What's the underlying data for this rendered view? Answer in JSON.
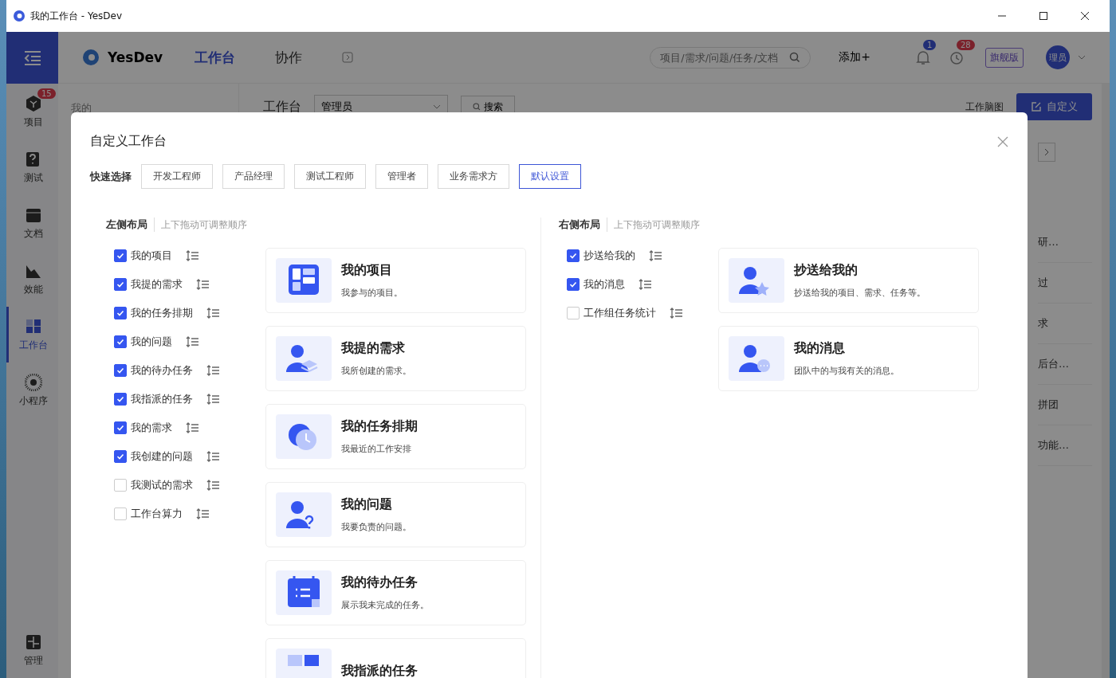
{
  "window": {
    "title": "我的工作台 - YesDev"
  },
  "nav": {
    "items": [
      {
        "label": "项目",
        "kind": "cube",
        "badge": "15",
        "selected": false
      },
      {
        "label": "测试",
        "kind": "test",
        "selected": false
      },
      {
        "label": "文档",
        "kind": "doc",
        "selected": false
      },
      {
        "label": "效能",
        "kind": "chart",
        "selected": false
      },
      {
        "label": "工作台",
        "kind": "grid",
        "selected": true
      },
      {
        "label": "小程序",
        "kind": "qr",
        "selected": false
      }
    ],
    "bottom": {
      "label": "管理",
      "kind": "admin"
    }
  },
  "header": {
    "logo": "YesDev",
    "tabs": [
      {
        "label": "工作台",
        "selected": true
      },
      {
        "label": "协作",
        "selected": false
      }
    ],
    "search": {
      "placeholder": "项目/需求/问题/任务/文档"
    },
    "add": "添加+",
    "notifications": "1",
    "reminders": "28",
    "edition": "旗舰版",
    "avatar": "理员"
  },
  "sub_sidebar": {
    "heading": "我的"
  },
  "toolbar": {
    "title": "工作台",
    "role": "管理员",
    "search_button": "搜索",
    "mindmap": "工作脑图",
    "customize": "自定义"
  },
  "background_rows": [
    "研…",
    "过",
    "求",
    "后台…",
    "拼团",
    "功能…"
  ],
  "dialog": {
    "title": "自定义工作台",
    "quick_select": {
      "label": "快速选择",
      "options": [
        {
          "label": "开发工程师",
          "selected": false
        },
        {
          "label": "产品经理",
          "selected": false
        },
        {
          "label": "测试工程师",
          "selected": false
        },
        {
          "label": "管理者",
          "selected": false
        },
        {
          "label": "业务需求方",
          "selected": false
        },
        {
          "label": "默认设置",
          "selected": true
        }
      ]
    },
    "left": {
      "title": "左侧布局",
      "hint": "上下拖动可调整顺序",
      "items": [
        {
          "label": "我的项目",
          "checked": true
        },
        {
          "label": "我提的需求",
          "checked": true
        },
        {
          "label": "我的任务排期",
          "checked": true
        },
        {
          "label": "我的问题",
          "checked": true
        },
        {
          "label": "我的待办任务",
          "checked": true
        },
        {
          "label": "我指派的任务",
          "checked": true
        },
        {
          "label": "我的需求",
          "checked": true
        },
        {
          "label": "我创建的问题",
          "checked": true
        },
        {
          "label": "我测试的需求",
          "checked": false
        },
        {
          "label": "工作台算力",
          "checked": false
        }
      ],
      "cards": [
        {
          "title": "我的项目",
          "desc": "我参与的项目。",
          "kind": "dashboard"
        },
        {
          "title": "我提的需求",
          "desc": "我所创建的需求。",
          "kind": "person-layers"
        },
        {
          "title": "我的任务排期",
          "desc": "我最近的工作安排",
          "kind": "clock"
        },
        {
          "title": "我的问题",
          "desc": "我要负责的问题。",
          "kind": "person-question"
        },
        {
          "title": "我的待办任务",
          "desc": "展示我未完成的任务。",
          "kind": "calendar"
        },
        {
          "title": "我指派的任务",
          "kind": "board"
        }
      ]
    },
    "right": {
      "title": "右侧布局",
      "hint": "上下拖动可调整顺序",
      "items": [
        {
          "label": "抄送给我的",
          "checked": true
        },
        {
          "label": "我的消息",
          "checked": true
        },
        {
          "label": "工作组任务统计",
          "checked": false
        }
      ],
      "cards": [
        {
          "title": "抄送给我的",
          "desc": "抄送给我的项目、需求、任务等。",
          "kind": "person-star"
        },
        {
          "title": "我的消息",
          "desc": "团队中的与我有关的消息。",
          "kind": "person-chat"
        }
      ]
    }
  }
}
